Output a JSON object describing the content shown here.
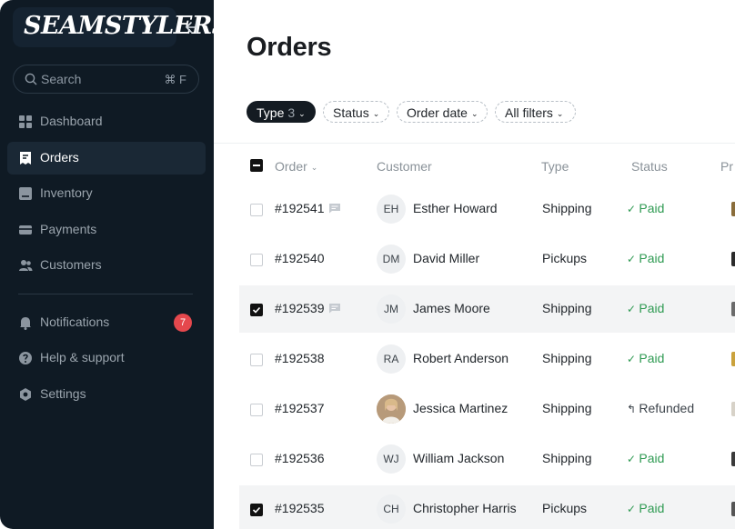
{
  "brand": {
    "name": "SEAMSTYLERS"
  },
  "search": {
    "placeholder": "Search",
    "shortcut": "⌘ F"
  },
  "sidebar": {
    "items": [
      {
        "label": "Dashboard",
        "icon": "grid-icon"
      },
      {
        "label": "Orders",
        "icon": "receipt-icon",
        "active": true
      },
      {
        "label": "Inventory",
        "icon": "inventory-icon"
      },
      {
        "label": "Payments",
        "icon": "card-icon"
      },
      {
        "label": "Customers",
        "icon": "users-icon"
      }
    ],
    "secondary": [
      {
        "label": "Notifications",
        "icon": "bell-icon",
        "badge": "7"
      },
      {
        "label": "Help & support",
        "icon": "help-icon"
      },
      {
        "label": "Settings",
        "icon": "settings-icon"
      }
    ]
  },
  "page": {
    "title": "Orders"
  },
  "filters": {
    "type": {
      "label": "Type",
      "count": "3"
    },
    "status": "Status",
    "order_date": "Order date",
    "all": "All filters"
  },
  "table": {
    "columns": {
      "order": "Order",
      "customer": "Customer",
      "type": "Type",
      "status": "Status",
      "product": "Pr"
    },
    "rows": [
      {
        "id": "#192541",
        "note": true,
        "initials": "EH",
        "customer": "Esther Howard",
        "type": "Shipping",
        "status": "Paid",
        "status_icon": "check-icon",
        "selected": false
      },
      {
        "id": "#192540",
        "note": false,
        "initials": "DM",
        "customer": "David Miller",
        "type": "Pickups",
        "status": "Paid",
        "status_icon": "check-icon",
        "selected": false
      },
      {
        "id": "#192539",
        "note": true,
        "initials": "JM",
        "customer": "James Moore",
        "type": "Shipping",
        "status": "Paid",
        "status_icon": "check-icon",
        "selected": true
      },
      {
        "id": "#192538",
        "note": false,
        "initials": "RA",
        "customer": "Robert Anderson",
        "type": "Shipping",
        "status": "Paid",
        "status_icon": "check-icon",
        "selected": false
      },
      {
        "id": "#192537",
        "note": false,
        "initials": "",
        "photo": true,
        "customer": "Jessica Martinez",
        "type": "Shipping",
        "status": "Refunded",
        "status_icon": "refund-icon",
        "selected": false
      },
      {
        "id": "#192536",
        "note": false,
        "initials": "WJ",
        "customer": "William Jackson",
        "type": "Shipping",
        "status": "Paid",
        "status_icon": "check-icon",
        "selected": false
      },
      {
        "id": "#192535",
        "note": false,
        "initials": "CH",
        "customer": "Christopher Harris",
        "type": "Pickups",
        "status": "Paid",
        "status_icon": "check-icon",
        "selected": true
      }
    ]
  },
  "colors": {
    "sidebar_bg": "#0f1a24",
    "paid": "#2e9a52",
    "badge": "#e5484d"
  }
}
